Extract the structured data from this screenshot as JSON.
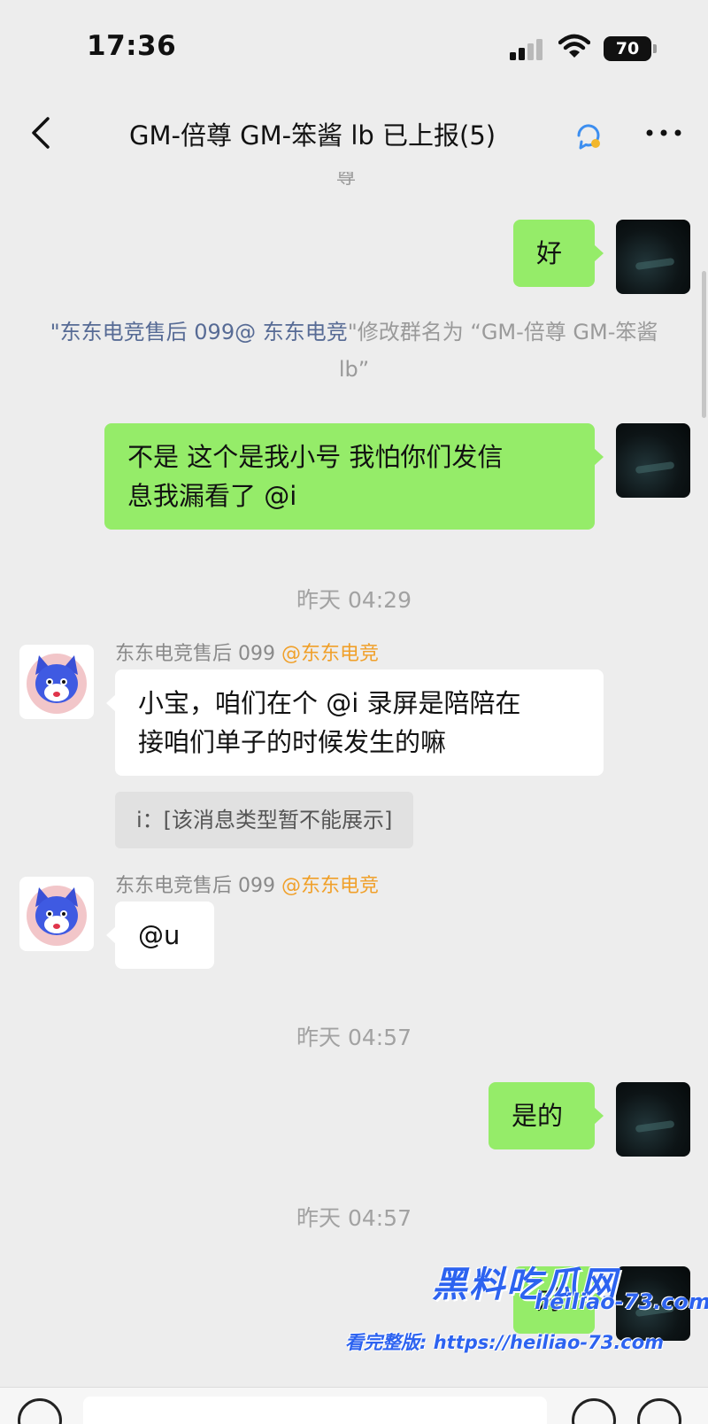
{
  "status_bar": {
    "time": "17:36",
    "battery": "70"
  },
  "nav": {
    "title": "GM-倍尊 GM-笨酱  lb 已上报(5)"
  },
  "chat": {
    "cut_top_text": "尊",
    "messages": [
      {
        "kind": "me",
        "text": "好"
      },
      {
        "kind": "system",
        "link": "\"东东电竞售后 099@ 东东电竞",
        "text": "\"修改群名为 “GM-倍尊 GM-笨酱  lb”"
      },
      {
        "kind": "me",
        "line1": "不是 这个是我小号 我怕你们发信",
        "line2": "息我漏看了 @i"
      },
      {
        "kind": "time",
        "text": "昨天 04:29"
      },
      {
        "kind": "other",
        "sender": "东东电竞售后 099",
        "tag": "@东东电竞",
        "line1": "小宝，咱们在个 @i 录屏是陪陪在",
        "line2": "接咱们单子的时候发生的嘛",
        "quote": "i：[该消息类型暂不能展示]"
      },
      {
        "kind": "other",
        "sender": "东东电竞售后 099",
        "tag": "@东东电竞",
        "text": "@u"
      },
      {
        "kind": "time",
        "text": "昨天 04:57"
      },
      {
        "kind": "me",
        "text": "是的"
      },
      {
        "kind": "time",
        "text": "昨天 04:57"
      },
      {
        "kind": "me",
        "text": "对"
      }
    ]
  },
  "watermark": {
    "title": "黑料吃瓜网",
    "url": "heiliao-73.com",
    "line": "看完整版: https://heiliao-73.com"
  },
  "colors": {
    "background": "#ededed",
    "my_bubble": "#95ec69",
    "other_bubble": "#ffffff",
    "link": "#576b95",
    "sender_tag": "#f0a02a",
    "watermark": "#2d63f0"
  },
  "icons": [
    "back-arrow-icon",
    "signal-icon",
    "wifi-icon",
    "battery-icon",
    "chat-refresh-icon",
    "more-icon",
    "voice-icon",
    "emoji-icon",
    "plus-icon"
  ]
}
